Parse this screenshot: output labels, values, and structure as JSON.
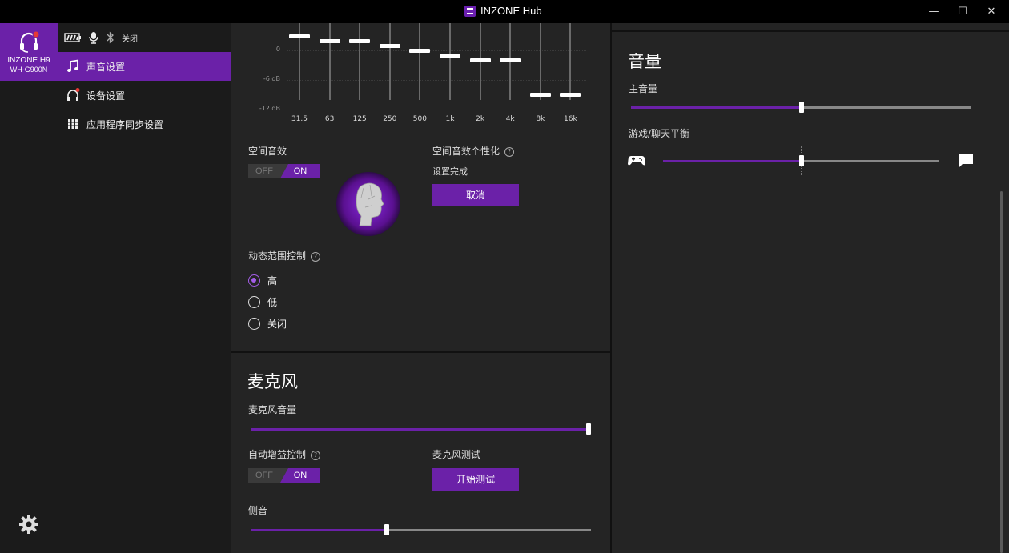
{
  "window": {
    "title": "INZONE Hub",
    "minimize_glyph": "—",
    "maximize_glyph": "☐",
    "close_glyph": "✕"
  },
  "device": {
    "name": "INZONE H9",
    "model": "WH-G900N",
    "bluetooth_status": "关闭"
  },
  "nav": {
    "items": [
      {
        "label": "声音设置",
        "icon": "music-note-icon",
        "selected": true
      },
      {
        "label": "设备设置",
        "icon": "headphones-icon",
        "selected": false
      },
      {
        "label": "应用程序同步设置",
        "icon": "grid-icon",
        "selected": false
      }
    ]
  },
  "equalizer": {
    "y_labels": [
      "0",
      "-6 dB",
      "-12 dB"
    ],
    "bands": [
      "31.5",
      "63",
      "125",
      "250",
      "500",
      "1k",
      "2k",
      "4k",
      "8k",
      "16k"
    ],
    "gains_db": [
      3,
      2,
      2,
      1,
      0,
      -1,
      -2,
      -2,
      -9,
      -9
    ]
  },
  "spatial_sound": {
    "label": "空间音效",
    "toggle_off": "OFF",
    "toggle_on": "ON",
    "state": "ON",
    "personalization_label": "空间音效个性化",
    "personalization_status": "设置完成",
    "cancel_button": "取消"
  },
  "dynamic_range": {
    "label": "动态范围控制",
    "options": [
      "高",
      "低",
      "关闭"
    ],
    "selected": "高"
  },
  "microphone": {
    "title": "麦克风",
    "volume_label": "麦克风音量",
    "volume_fraction": 1.0,
    "agc_label": "自动增益控制",
    "agc_state": "ON",
    "test_label": "麦克风测试",
    "test_button": "开始测试",
    "sidetone_label": "侧音",
    "sidetone_fraction": 0.4
  },
  "volume": {
    "title": "音量",
    "master_label": "主音量",
    "master_fraction": 0.5,
    "balance_label": "游戏/聊天平衡",
    "balance_fraction": 0.5
  },
  "colors": {
    "accent": "#6b21a8",
    "accent_light": "#a45de8",
    "notification": "#e53935"
  }
}
